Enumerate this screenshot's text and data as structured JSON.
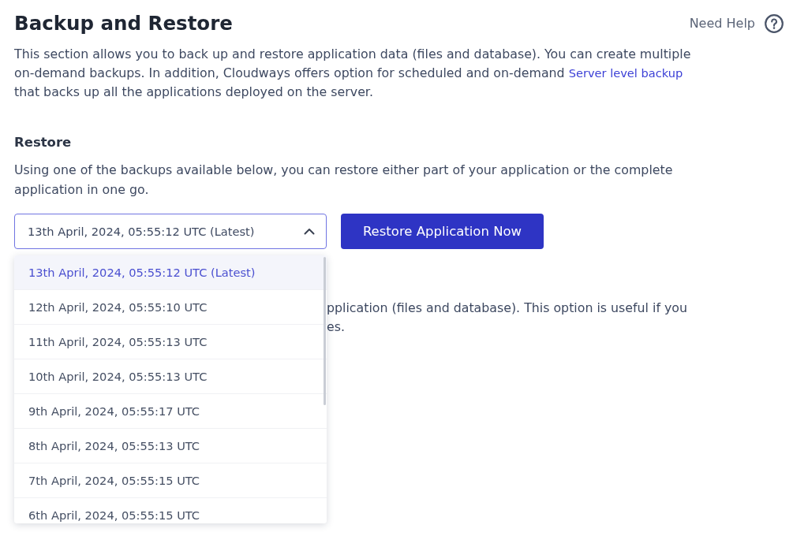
{
  "header": {
    "title": "Backup and Restore",
    "help_link": "Need Help"
  },
  "intro": {
    "text_before": "This section allows you to back up and restore application data (files and database). You can create multiple on-demand backups. In addition, Cloudways offers option for scheduled and on-demand",
    "link": "Server level backup",
    "text_after": "that backs up all the applications deployed on the server."
  },
  "restore": {
    "heading": "Restore",
    "description": "Using one of the backups available below, you can restore either part of your application or the complete application in one go.",
    "backup_select": {
      "value": "13th April, 2024, 05:55:12 UTC (Latest)",
      "expanded": true,
      "options": [
        {
          "label": "13th April, 2024, 05:55:12 UTC (Latest)",
          "selected": true
        },
        {
          "label": "12th April, 2024, 05:55:10 UTC",
          "selected": false
        },
        {
          "label": "11th April, 2024, 05:55:13 UTC",
          "selected": false
        },
        {
          "label": "10th April, 2024, 05:55:13 UTC",
          "selected": false
        },
        {
          "label": "9th April, 2024, 05:55:17 UTC",
          "selected": false
        },
        {
          "label": "8th April, 2024, 05:55:13 UTC",
          "selected": false
        },
        {
          "label": "7th April, 2024, 05:55:15 UTC",
          "selected": false
        },
        {
          "label": "6th April, 2024, 05:55:15 UTC",
          "selected": false
        }
      ]
    },
    "button": "Restore Application Now"
  },
  "partly_hidden_paragraph": [
    "pplication (files and database). This option is useful if you",
    "es."
  ]
}
